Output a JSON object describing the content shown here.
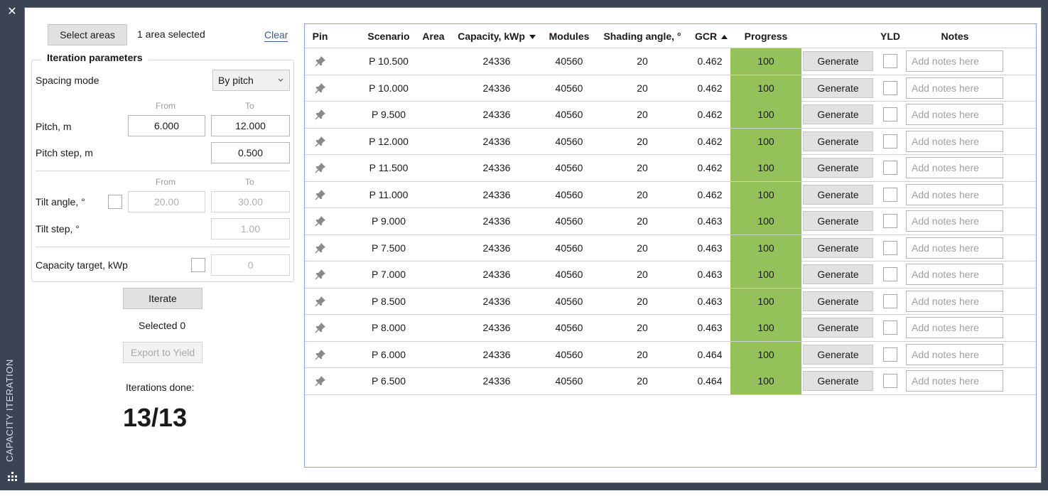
{
  "window": {
    "side_title": "CAPACITY ITERATION",
    "close_glyph": "✕"
  },
  "left": {
    "select_areas_label": "Select areas",
    "area_status": "1 area selected",
    "clear_label": "Clear",
    "group_title": "Iteration parameters",
    "spacing_mode_label": "Spacing mode",
    "spacing_mode_value": "By pitch",
    "from_label": "From",
    "to_label": "To",
    "pitch_label": "Pitch, m",
    "pitch_from": "6.000",
    "pitch_to": "12.000",
    "pitch_step_label": "Pitch step, m",
    "pitch_step": "0.500",
    "tilt_label": "Tilt angle, °",
    "tilt_from": "20.00",
    "tilt_to": "30.00",
    "tilt_step_label": "Tilt step, °",
    "tilt_step": "1.00",
    "capacity_label": "Capacity target, kWp",
    "capacity_value": "0",
    "iterate_label": "Iterate",
    "selected_text": "Selected 0",
    "export_label": "Export to Yield",
    "iterations_label": "Iterations done:",
    "iterations_value": "13/13"
  },
  "table": {
    "headers": {
      "pin": "Pin",
      "scenario": "Scenario",
      "area": "Area",
      "capacity": "Capacity, kWp",
      "modules": "Modules",
      "shading": "Shading angle, °",
      "gcr": "GCR",
      "progress": "Progress",
      "yld": "YLD",
      "notes": "Notes"
    },
    "generate_label": "Generate",
    "notes_placeholder": "Add notes here",
    "rows": [
      {
        "scenario": "P 10.500",
        "capacity": "24336",
        "modules": "40560",
        "shading": "20",
        "gcr": "0.462",
        "progress": "100"
      },
      {
        "scenario": "P 10.000",
        "capacity": "24336",
        "modules": "40560",
        "shading": "20",
        "gcr": "0.462",
        "progress": "100"
      },
      {
        "scenario": "P 9.500",
        "capacity": "24336",
        "modules": "40560",
        "shading": "20",
        "gcr": "0.462",
        "progress": "100"
      },
      {
        "scenario": "P 12.000",
        "capacity": "24336",
        "modules": "40560",
        "shading": "20",
        "gcr": "0.462",
        "progress": "100"
      },
      {
        "scenario": "P 11.500",
        "capacity": "24336",
        "modules": "40560",
        "shading": "20",
        "gcr": "0.462",
        "progress": "100"
      },
      {
        "scenario": "P 11.000",
        "capacity": "24336",
        "modules": "40560",
        "shading": "20",
        "gcr": "0.462",
        "progress": "100"
      },
      {
        "scenario": "P 9.000",
        "capacity": "24336",
        "modules": "40560",
        "shading": "20",
        "gcr": "0.463",
        "progress": "100"
      },
      {
        "scenario": "P 7.500",
        "capacity": "24336",
        "modules": "40560",
        "shading": "20",
        "gcr": "0.463",
        "progress": "100"
      },
      {
        "scenario": "P 7.000",
        "capacity": "24336",
        "modules": "40560",
        "shading": "20",
        "gcr": "0.463",
        "progress": "100"
      },
      {
        "scenario": "P 8.500",
        "capacity": "24336",
        "modules": "40560",
        "shading": "20",
        "gcr": "0.463",
        "progress": "100"
      },
      {
        "scenario": "P 8.000",
        "capacity": "24336",
        "modules": "40560",
        "shading": "20",
        "gcr": "0.463",
        "progress": "100"
      },
      {
        "scenario": "P 6.000",
        "capacity": "24336",
        "modules": "40560",
        "shading": "20",
        "gcr": "0.464",
        "progress": "100"
      },
      {
        "scenario": "P 6.500",
        "capacity": "24336",
        "modules": "40560",
        "shading": "20",
        "gcr": "0.464",
        "progress": "100"
      }
    ]
  },
  "colors": {
    "frame": "#3b4453",
    "progress_fill": "#94c15a",
    "table_border": "#8aa4c8",
    "link": "#3c5a8a"
  },
  "icons": {
    "close": "close-icon",
    "pin": "pin-icon",
    "sort_desc": "sort-desc-icon",
    "sort_asc": "sort-asc-icon",
    "dropdown": "chevron-down-icon",
    "grip": "grip-icon"
  }
}
